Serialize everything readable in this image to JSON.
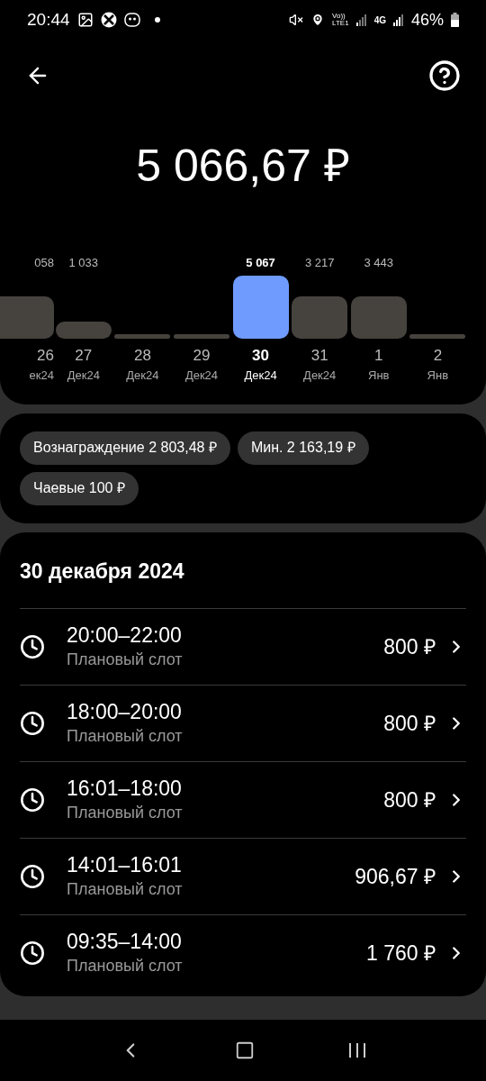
{
  "status_bar": {
    "time": "20:44",
    "network_top": "Vo))",
    "network_bottom": "LTE1",
    "network2": "4G",
    "battery": "46%"
  },
  "total": "5 066,67 ₽",
  "days": [
    {
      "value": "058",
      "day": "26",
      "month": "ек24",
      "kind": "high",
      "selected": false
    },
    {
      "value": "1 033",
      "day": "27",
      "month": "Дек24",
      "kind": "low",
      "selected": false
    },
    {
      "day": "28",
      "month": "Дек24",
      "kind": "empty",
      "selected": false
    },
    {
      "day": "29",
      "month": "Дек24",
      "kind": "empty",
      "selected": false
    },
    {
      "value": "5 067",
      "day": "30",
      "month": "Дек24",
      "kind": "peak",
      "selected": true
    },
    {
      "value": "3 217",
      "day": "31",
      "month": "Дек24",
      "kind": "high",
      "selected": false
    },
    {
      "value": "3 443",
      "day": "1",
      "month": "Янв",
      "kind": "high",
      "selected": false
    },
    {
      "day": "2",
      "month": "Янв",
      "kind": "empty",
      "selected": false
    }
  ],
  "chips": [
    "Вознаграждение 2 803,48 ₽",
    "Мин. 2 163,19 ₽",
    "Чаевые 100 ₽"
  ],
  "date_title": "30 декабря 2024",
  "slots": [
    {
      "time": "20:00–22:00",
      "type": "Плановый слот",
      "amount": "800 ₽"
    },
    {
      "time": "18:00–20:00",
      "type": "Плановый слот",
      "amount": "800 ₽"
    },
    {
      "time": "16:01–18:00",
      "type": "Плановый слот",
      "amount": "800 ₽"
    },
    {
      "time": "14:01–16:01",
      "type": "Плановый слот",
      "amount": "906,67 ₽"
    },
    {
      "time": "09:35–14:00",
      "type": "Плановый слот",
      "amount": "1 760 ₽"
    }
  ]
}
